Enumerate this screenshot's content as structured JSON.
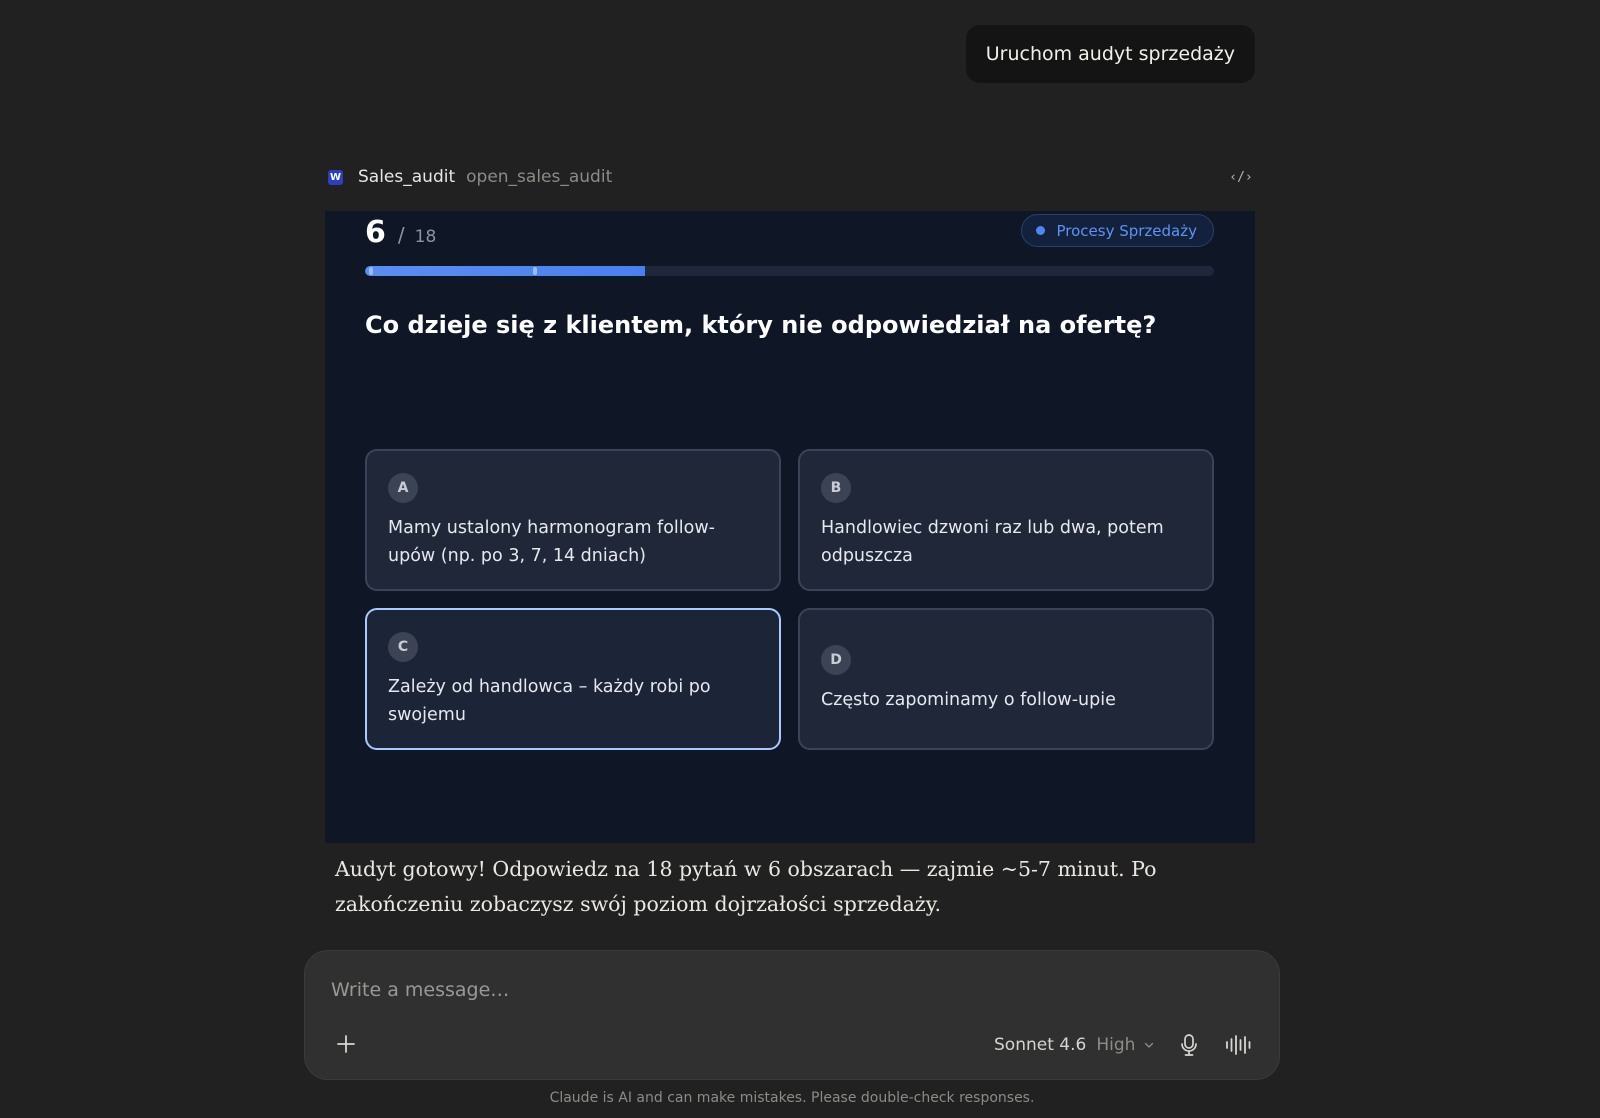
{
  "user_message": "Uruchom audyt sprzedaży",
  "tool": {
    "logo_letter": "W",
    "name": "Sales_audit",
    "function": "open_sales_audit",
    "code_icon": "code-icon"
  },
  "quiz": {
    "current": "6",
    "separator": "/",
    "total": "18",
    "category": "Procesy Sprzedaży",
    "progress": 0.33,
    "question": "Co dzieje się z klientem, który nie odpowiedział na ofertę?",
    "options": [
      {
        "letter": "A",
        "text": "Mamy ustalony harmonogram follow-upów (np. po 3, 7, 14 dniach)",
        "selected": false
      },
      {
        "letter": "B",
        "text": "Handlowiec dzwoni raz lub dwa, potem odpuszcza",
        "selected": false
      },
      {
        "letter": "C",
        "text": "Zależy od handlowca – każdy robi po swojemu",
        "selected": true
      },
      {
        "letter": "D",
        "text": "Często zapominamy o follow-upie",
        "selected": false
      }
    ]
  },
  "assistant_text": "Audyt gotowy! Odpowiedz na 18 pytań w 6 obszarach — zajmie ~5-7 minut. Po zakończeniu zobaczysz swój poziom dojrzałości sprzedaży.",
  "composer": {
    "placeholder": "Write a message…",
    "model": "Sonnet 4.6",
    "effort": "High"
  },
  "disclaimer": "Claude is AI and can make mistakes. Please double-check responses.",
  "colors": {
    "background": "#212121",
    "quiz_background": "#0f1626",
    "accent": "#4f86f0",
    "selected_border": "#a9c9ff"
  }
}
